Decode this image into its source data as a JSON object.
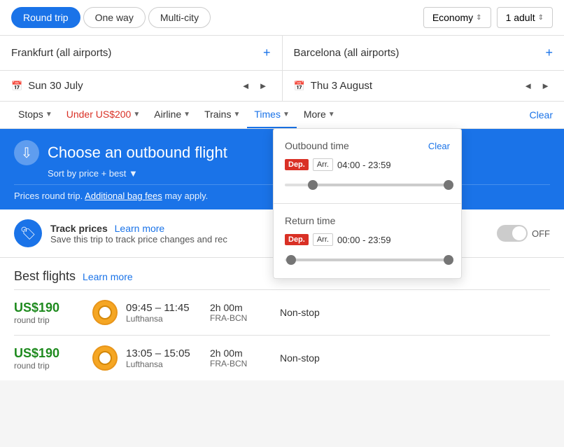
{
  "tripType": {
    "options": [
      "Round trip",
      "One way",
      "Multi-city"
    ],
    "active": "Round trip"
  },
  "classSelect": {
    "label": "Economy",
    "value": "economy"
  },
  "passengerSelect": {
    "label": "1 adult"
  },
  "origin": {
    "value": "Frankfurt (all airports)",
    "placeholder": "From"
  },
  "destination": {
    "value": "Barcelona (all airports)",
    "placeholder": "To"
  },
  "departure": {
    "icon": "31",
    "date": "Sun 30 July"
  },
  "returnDate": {
    "icon": "31",
    "date": "Thu 3 August"
  },
  "filters": {
    "items": [
      {
        "label": "Stops",
        "hasArrow": true
      },
      {
        "label": "Under US$200",
        "hasArrow": true,
        "isPrice": true
      },
      {
        "label": "Airline",
        "hasArrow": true
      },
      {
        "label": "Trains",
        "hasArrow": true
      },
      {
        "label": "Times",
        "hasArrow": true,
        "active": true
      },
      {
        "label": "More",
        "hasArrow": true
      }
    ],
    "clear": "Clear"
  },
  "timesDropdown": {
    "outbound": {
      "title": "Outbound time",
      "clear": "Clear",
      "dep": "Dep.",
      "arr": "Arr.",
      "range": "04:00 - 23:59",
      "sliderLeftPct": 15,
      "sliderRightPct": 98
    },
    "return": {
      "title": "Return time",
      "dep": "Dep.",
      "arr": "Arr.",
      "range": "00:00 - 23:59",
      "sliderLeftPct": 2,
      "sliderRightPct": 98
    }
  },
  "outboundBanner": {
    "title": "Choose an outbound flight",
    "sortLabel": "Sort by price + best",
    "pricesNote": "Prices round trip.",
    "bagFees": "Additional bag fees",
    "bagFeesAfter": "may apply."
  },
  "trackPrices": {
    "title": "Track prices",
    "learnMore": "Learn more",
    "description": "Save this trip to track price changes and rec",
    "toggleLabel": "OFF"
  },
  "bestFlights": {
    "title": "Best flights",
    "learnMore": "Learn more",
    "flights": [
      {
        "price": "US$190",
        "priceType": "round trip",
        "times": "09:45 – 11:45",
        "airline": "Lufthansa",
        "duration": "2h 00m",
        "route": "FRA-BCN",
        "stops": "Non-stop"
      },
      {
        "price": "US$190",
        "priceType": "round trip",
        "times": "13:05 – 15:05",
        "airline": "Lufthansa",
        "duration": "2h 00m",
        "route": "FRA-BCN",
        "stops": "Non-stop"
      }
    ]
  }
}
